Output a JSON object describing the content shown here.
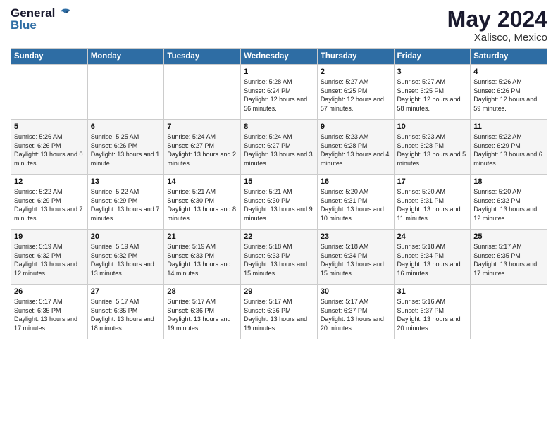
{
  "logo": {
    "text_general": "General",
    "text_blue": "Blue"
  },
  "title": "May 2024",
  "location": "Xalisco, Mexico",
  "weekdays": [
    "Sunday",
    "Monday",
    "Tuesday",
    "Wednesday",
    "Thursday",
    "Friday",
    "Saturday"
  ],
  "weeks": [
    [
      {
        "day": "",
        "sunrise": "",
        "sunset": "",
        "daylight": ""
      },
      {
        "day": "",
        "sunrise": "",
        "sunset": "",
        "daylight": ""
      },
      {
        "day": "",
        "sunrise": "",
        "sunset": "",
        "daylight": ""
      },
      {
        "day": "1",
        "sunrise": "Sunrise: 5:28 AM",
        "sunset": "Sunset: 6:24 PM",
        "daylight": "Daylight: 12 hours and 56 minutes."
      },
      {
        "day": "2",
        "sunrise": "Sunrise: 5:27 AM",
        "sunset": "Sunset: 6:25 PM",
        "daylight": "Daylight: 12 hours and 57 minutes."
      },
      {
        "day": "3",
        "sunrise": "Sunrise: 5:27 AM",
        "sunset": "Sunset: 6:25 PM",
        "daylight": "Daylight: 12 hours and 58 minutes."
      },
      {
        "day": "4",
        "sunrise": "Sunrise: 5:26 AM",
        "sunset": "Sunset: 6:26 PM",
        "daylight": "Daylight: 12 hours and 59 minutes."
      }
    ],
    [
      {
        "day": "5",
        "sunrise": "Sunrise: 5:26 AM",
        "sunset": "Sunset: 6:26 PM",
        "daylight": "Daylight: 13 hours and 0 minutes."
      },
      {
        "day": "6",
        "sunrise": "Sunrise: 5:25 AM",
        "sunset": "Sunset: 6:26 PM",
        "daylight": "Daylight: 13 hours and 1 minute."
      },
      {
        "day": "7",
        "sunrise": "Sunrise: 5:24 AM",
        "sunset": "Sunset: 6:27 PM",
        "daylight": "Daylight: 13 hours and 2 minutes."
      },
      {
        "day": "8",
        "sunrise": "Sunrise: 5:24 AM",
        "sunset": "Sunset: 6:27 PM",
        "daylight": "Daylight: 13 hours and 3 minutes."
      },
      {
        "day": "9",
        "sunrise": "Sunrise: 5:23 AM",
        "sunset": "Sunset: 6:28 PM",
        "daylight": "Daylight: 13 hours and 4 minutes."
      },
      {
        "day": "10",
        "sunrise": "Sunrise: 5:23 AM",
        "sunset": "Sunset: 6:28 PM",
        "daylight": "Daylight: 13 hours and 5 minutes."
      },
      {
        "day": "11",
        "sunrise": "Sunrise: 5:22 AM",
        "sunset": "Sunset: 6:29 PM",
        "daylight": "Daylight: 13 hours and 6 minutes."
      }
    ],
    [
      {
        "day": "12",
        "sunrise": "Sunrise: 5:22 AM",
        "sunset": "Sunset: 6:29 PM",
        "daylight": "Daylight: 13 hours and 7 minutes."
      },
      {
        "day": "13",
        "sunrise": "Sunrise: 5:22 AM",
        "sunset": "Sunset: 6:29 PM",
        "daylight": "Daylight: 13 hours and 7 minutes."
      },
      {
        "day": "14",
        "sunrise": "Sunrise: 5:21 AM",
        "sunset": "Sunset: 6:30 PM",
        "daylight": "Daylight: 13 hours and 8 minutes."
      },
      {
        "day": "15",
        "sunrise": "Sunrise: 5:21 AM",
        "sunset": "Sunset: 6:30 PM",
        "daylight": "Daylight: 13 hours and 9 minutes."
      },
      {
        "day": "16",
        "sunrise": "Sunrise: 5:20 AM",
        "sunset": "Sunset: 6:31 PM",
        "daylight": "Daylight: 13 hours and 10 minutes."
      },
      {
        "day": "17",
        "sunrise": "Sunrise: 5:20 AM",
        "sunset": "Sunset: 6:31 PM",
        "daylight": "Daylight: 13 hours and 11 minutes."
      },
      {
        "day": "18",
        "sunrise": "Sunrise: 5:20 AM",
        "sunset": "Sunset: 6:32 PM",
        "daylight": "Daylight: 13 hours and 12 minutes."
      }
    ],
    [
      {
        "day": "19",
        "sunrise": "Sunrise: 5:19 AM",
        "sunset": "Sunset: 6:32 PM",
        "daylight": "Daylight: 13 hours and 12 minutes."
      },
      {
        "day": "20",
        "sunrise": "Sunrise: 5:19 AM",
        "sunset": "Sunset: 6:32 PM",
        "daylight": "Daylight: 13 hours and 13 minutes."
      },
      {
        "day": "21",
        "sunrise": "Sunrise: 5:19 AM",
        "sunset": "Sunset: 6:33 PM",
        "daylight": "Daylight: 13 hours and 14 minutes."
      },
      {
        "day": "22",
        "sunrise": "Sunrise: 5:18 AM",
        "sunset": "Sunset: 6:33 PM",
        "daylight": "Daylight: 13 hours and 15 minutes."
      },
      {
        "day": "23",
        "sunrise": "Sunrise: 5:18 AM",
        "sunset": "Sunset: 6:34 PM",
        "daylight": "Daylight: 13 hours and 15 minutes."
      },
      {
        "day": "24",
        "sunrise": "Sunrise: 5:18 AM",
        "sunset": "Sunset: 6:34 PM",
        "daylight": "Daylight: 13 hours and 16 minutes."
      },
      {
        "day": "25",
        "sunrise": "Sunrise: 5:17 AM",
        "sunset": "Sunset: 6:35 PM",
        "daylight": "Daylight: 13 hours and 17 minutes."
      }
    ],
    [
      {
        "day": "26",
        "sunrise": "Sunrise: 5:17 AM",
        "sunset": "Sunset: 6:35 PM",
        "daylight": "Daylight: 13 hours and 17 minutes."
      },
      {
        "day": "27",
        "sunrise": "Sunrise: 5:17 AM",
        "sunset": "Sunset: 6:35 PM",
        "daylight": "Daylight: 13 hours and 18 minutes."
      },
      {
        "day": "28",
        "sunrise": "Sunrise: 5:17 AM",
        "sunset": "Sunset: 6:36 PM",
        "daylight": "Daylight: 13 hours and 19 minutes."
      },
      {
        "day": "29",
        "sunrise": "Sunrise: 5:17 AM",
        "sunset": "Sunset: 6:36 PM",
        "daylight": "Daylight: 13 hours and 19 minutes."
      },
      {
        "day": "30",
        "sunrise": "Sunrise: 5:17 AM",
        "sunset": "Sunset: 6:37 PM",
        "daylight": "Daylight: 13 hours and 20 minutes."
      },
      {
        "day": "31",
        "sunrise": "Sunrise: 5:16 AM",
        "sunset": "Sunset: 6:37 PM",
        "daylight": "Daylight: 13 hours and 20 minutes."
      },
      {
        "day": "",
        "sunrise": "",
        "sunset": "",
        "daylight": ""
      }
    ]
  ]
}
